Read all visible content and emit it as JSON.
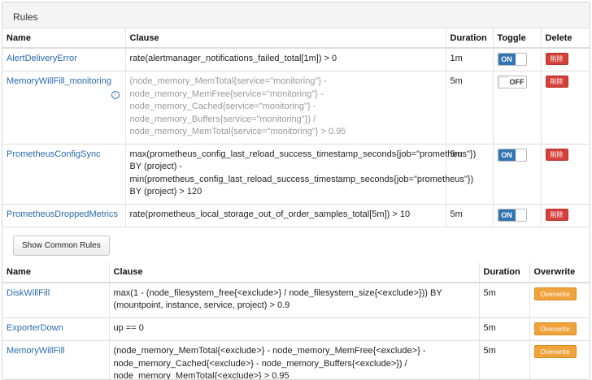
{
  "panel": {
    "title": "Rules"
  },
  "rules_table": {
    "headers": {
      "name": "Name",
      "clause": "Clause",
      "duration": "Duration",
      "toggle": "Toggle",
      "delete": "Delete"
    },
    "rows": [
      {
        "name": "AlertDeliveryError",
        "clause": "rate(alertmanager_notifications_failed_total[1m]) > 0",
        "duration": "1m",
        "toggle": "ON",
        "enabled": true,
        "delete_label": "削除",
        "clause_muted": false
      },
      {
        "name": "MemoryWillFill_monitoring",
        "clause": "(node_memory_MemTotal{service=\"monitoring\"} - node_memory_MemFree{service=\"monitoring\"} - node_memory_Cached{service=\"monitoring\"} - node_memory_Buffers{service=\"monitoring\"}) / node_memory_MemTotal{service=\"monitoring\"} > 0.95",
        "duration": "5m",
        "toggle": "OFF",
        "enabled": false,
        "delete_label": "削除",
        "clause_muted": true,
        "info_icon": "arrow-up-circle-icon"
      },
      {
        "name": "PrometheusConfigSync",
        "clause": "max(prometheus_config_last_reload_success_timestamp_seconds{job=\"prometheus\"}) BY (project) - min(prometheus_config_last_reload_success_timestamp_seconds{job=\"prometheus\"}) BY (project) > 120",
        "duration": "5m",
        "toggle": "ON",
        "enabled": true,
        "delete_label": "削除",
        "clause_muted": false
      },
      {
        "name": "PrometheusDroppedMetrics",
        "clause": "rate(prometheus_local_storage_out_of_order_samples_total[5m]) > 10",
        "duration": "5m",
        "toggle": "ON",
        "enabled": true,
        "delete_label": "削除",
        "clause_muted": false
      }
    ]
  },
  "show_common_button": "Show Common Rules",
  "common_table": {
    "headers": {
      "name": "Name",
      "clause": "Clause",
      "duration": "Duration",
      "overwrite": "Overwrite"
    },
    "rows": [
      {
        "name": "DiskWillFill",
        "clause": "max(1 - (node_filesystem_free{<exclude>} / node_filesystem_size{<exclude>})) BY (mountpoint, instance, service, project) > 0.9",
        "duration": "5m",
        "overwrite": "Overwrite"
      },
      {
        "name": "ExporterDown",
        "clause": "up == 0",
        "duration": "5m",
        "overwrite": "Overwrite"
      },
      {
        "name": "MemoryWillFill",
        "clause": "(node_memory_MemTotal{<exclude>} - node_memory_MemFree{<exclude>} - node_memory_Cached{<exclude>} - node_memory_Buffers{<exclude>}) / node_memory_MemTotal{<exclude>} > 0.95",
        "duration": "5m",
        "overwrite": "Overwrite"
      }
    ]
  },
  "colors": {
    "link": "#2a6aad",
    "toggle_on": "#3276b1",
    "delete": "#d43f3a",
    "overwrite": "#f0a33c"
  }
}
